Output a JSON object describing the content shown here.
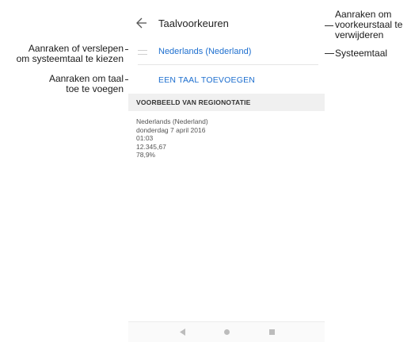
{
  "callouts": {
    "drag": [
      "Aanraken of verslepen",
      "om systeemtaal te kiezen"
    ],
    "add": [
      "Aanraken om taal",
      "toe te voegen"
    ],
    "remove": [
      "Aanraken om",
      "voorkeurstaal te",
      "verwijderen"
    ],
    "system": "Systeemtaal"
  },
  "appbar": {
    "title": "Taalvoorkeuren",
    "back_icon": "arrow-left-icon"
  },
  "language_list": {
    "items": [
      {
        "name": "Nederlands (Nederland)"
      }
    ]
  },
  "actions": {
    "add_language": "EEN TAAL TOEVOEGEN"
  },
  "regional": {
    "header": "VOORBEELD VAN REGIONOTATIE",
    "examples": [
      "Nederlands (Nederland)",
      "donderdag 7 april 2016",
      "01:03",
      "12.345,67",
      "78,9%"
    ]
  },
  "navbar": {
    "back_icon": "triangle-back-icon",
    "home_icon": "circle-home-icon",
    "recent_icon": "square-recent-icon"
  },
  "colors": {
    "accent": "#1e6fcf",
    "section_bg": "#f0f0f0"
  }
}
